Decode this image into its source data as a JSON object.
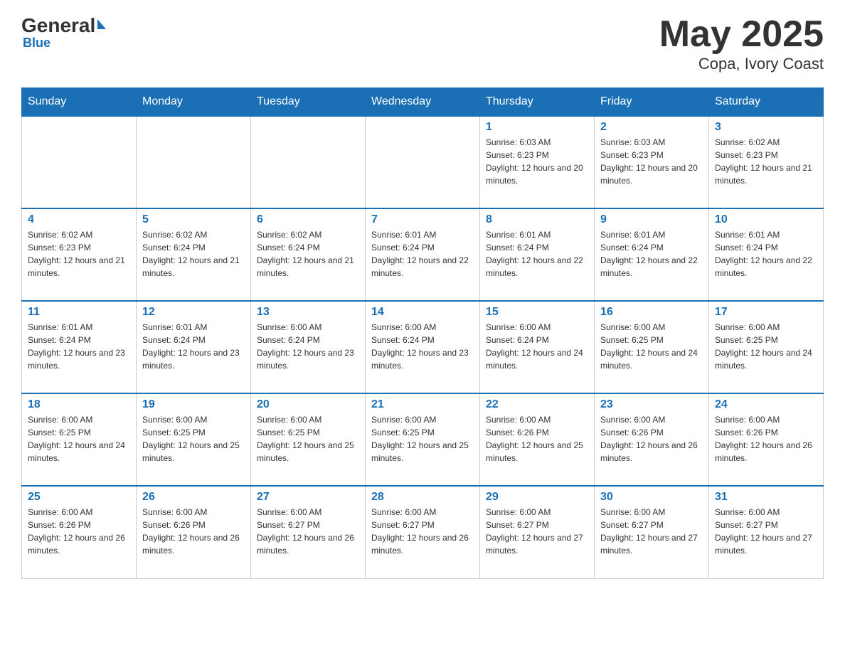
{
  "header": {
    "logo_general": "General",
    "logo_blue": "Blue",
    "month_title": "May 2025",
    "location": "Copa, Ivory Coast"
  },
  "days_of_week": [
    "Sunday",
    "Monday",
    "Tuesday",
    "Wednesday",
    "Thursday",
    "Friday",
    "Saturday"
  ],
  "weeks": [
    [
      {
        "day": "",
        "sunrise": "",
        "sunset": "",
        "daylight": ""
      },
      {
        "day": "",
        "sunrise": "",
        "sunset": "",
        "daylight": ""
      },
      {
        "day": "",
        "sunrise": "",
        "sunset": "",
        "daylight": ""
      },
      {
        "day": "",
        "sunrise": "",
        "sunset": "",
        "daylight": ""
      },
      {
        "day": "1",
        "sunrise": "Sunrise: 6:03 AM",
        "sunset": "Sunset: 6:23 PM",
        "daylight": "Daylight: 12 hours and 20 minutes."
      },
      {
        "day": "2",
        "sunrise": "Sunrise: 6:03 AM",
        "sunset": "Sunset: 6:23 PM",
        "daylight": "Daylight: 12 hours and 20 minutes."
      },
      {
        "day": "3",
        "sunrise": "Sunrise: 6:02 AM",
        "sunset": "Sunset: 6:23 PM",
        "daylight": "Daylight: 12 hours and 21 minutes."
      }
    ],
    [
      {
        "day": "4",
        "sunrise": "Sunrise: 6:02 AM",
        "sunset": "Sunset: 6:23 PM",
        "daylight": "Daylight: 12 hours and 21 minutes."
      },
      {
        "day": "5",
        "sunrise": "Sunrise: 6:02 AM",
        "sunset": "Sunset: 6:24 PM",
        "daylight": "Daylight: 12 hours and 21 minutes."
      },
      {
        "day": "6",
        "sunrise": "Sunrise: 6:02 AM",
        "sunset": "Sunset: 6:24 PM",
        "daylight": "Daylight: 12 hours and 21 minutes."
      },
      {
        "day": "7",
        "sunrise": "Sunrise: 6:01 AM",
        "sunset": "Sunset: 6:24 PM",
        "daylight": "Daylight: 12 hours and 22 minutes."
      },
      {
        "day": "8",
        "sunrise": "Sunrise: 6:01 AM",
        "sunset": "Sunset: 6:24 PM",
        "daylight": "Daylight: 12 hours and 22 minutes."
      },
      {
        "day": "9",
        "sunrise": "Sunrise: 6:01 AM",
        "sunset": "Sunset: 6:24 PM",
        "daylight": "Daylight: 12 hours and 22 minutes."
      },
      {
        "day": "10",
        "sunrise": "Sunrise: 6:01 AM",
        "sunset": "Sunset: 6:24 PM",
        "daylight": "Daylight: 12 hours and 22 minutes."
      }
    ],
    [
      {
        "day": "11",
        "sunrise": "Sunrise: 6:01 AM",
        "sunset": "Sunset: 6:24 PM",
        "daylight": "Daylight: 12 hours and 23 minutes."
      },
      {
        "day": "12",
        "sunrise": "Sunrise: 6:01 AM",
        "sunset": "Sunset: 6:24 PM",
        "daylight": "Daylight: 12 hours and 23 minutes."
      },
      {
        "day": "13",
        "sunrise": "Sunrise: 6:00 AM",
        "sunset": "Sunset: 6:24 PM",
        "daylight": "Daylight: 12 hours and 23 minutes."
      },
      {
        "day": "14",
        "sunrise": "Sunrise: 6:00 AM",
        "sunset": "Sunset: 6:24 PM",
        "daylight": "Daylight: 12 hours and 23 minutes."
      },
      {
        "day": "15",
        "sunrise": "Sunrise: 6:00 AM",
        "sunset": "Sunset: 6:24 PM",
        "daylight": "Daylight: 12 hours and 24 minutes."
      },
      {
        "day": "16",
        "sunrise": "Sunrise: 6:00 AM",
        "sunset": "Sunset: 6:25 PM",
        "daylight": "Daylight: 12 hours and 24 minutes."
      },
      {
        "day": "17",
        "sunrise": "Sunrise: 6:00 AM",
        "sunset": "Sunset: 6:25 PM",
        "daylight": "Daylight: 12 hours and 24 minutes."
      }
    ],
    [
      {
        "day": "18",
        "sunrise": "Sunrise: 6:00 AM",
        "sunset": "Sunset: 6:25 PM",
        "daylight": "Daylight: 12 hours and 24 minutes."
      },
      {
        "day": "19",
        "sunrise": "Sunrise: 6:00 AM",
        "sunset": "Sunset: 6:25 PM",
        "daylight": "Daylight: 12 hours and 25 minutes."
      },
      {
        "day": "20",
        "sunrise": "Sunrise: 6:00 AM",
        "sunset": "Sunset: 6:25 PM",
        "daylight": "Daylight: 12 hours and 25 minutes."
      },
      {
        "day": "21",
        "sunrise": "Sunrise: 6:00 AM",
        "sunset": "Sunset: 6:25 PM",
        "daylight": "Daylight: 12 hours and 25 minutes."
      },
      {
        "day": "22",
        "sunrise": "Sunrise: 6:00 AM",
        "sunset": "Sunset: 6:26 PM",
        "daylight": "Daylight: 12 hours and 25 minutes."
      },
      {
        "day": "23",
        "sunrise": "Sunrise: 6:00 AM",
        "sunset": "Sunset: 6:26 PM",
        "daylight": "Daylight: 12 hours and 26 minutes."
      },
      {
        "day": "24",
        "sunrise": "Sunrise: 6:00 AM",
        "sunset": "Sunset: 6:26 PM",
        "daylight": "Daylight: 12 hours and 26 minutes."
      }
    ],
    [
      {
        "day": "25",
        "sunrise": "Sunrise: 6:00 AM",
        "sunset": "Sunset: 6:26 PM",
        "daylight": "Daylight: 12 hours and 26 minutes."
      },
      {
        "day": "26",
        "sunrise": "Sunrise: 6:00 AM",
        "sunset": "Sunset: 6:26 PM",
        "daylight": "Daylight: 12 hours and 26 minutes."
      },
      {
        "day": "27",
        "sunrise": "Sunrise: 6:00 AM",
        "sunset": "Sunset: 6:27 PM",
        "daylight": "Daylight: 12 hours and 26 minutes."
      },
      {
        "day": "28",
        "sunrise": "Sunrise: 6:00 AM",
        "sunset": "Sunset: 6:27 PM",
        "daylight": "Daylight: 12 hours and 26 minutes."
      },
      {
        "day": "29",
        "sunrise": "Sunrise: 6:00 AM",
        "sunset": "Sunset: 6:27 PM",
        "daylight": "Daylight: 12 hours and 27 minutes."
      },
      {
        "day": "30",
        "sunrise": "Sunrise: 6:00 AM",
        "sunset": "Sunset: 6:27 PM",
        "daylight": "Daylight: 12 hours and 27 minutes."
      },
      {
        "day": "31",
        "sunrise": "Sunrise: 6:00 AM",
        "sunset": "Sunset: 6:27 PM",
        "daylight": "Daylight: 12 hours and 27 minutes."
      }
    ]
  ]
}
